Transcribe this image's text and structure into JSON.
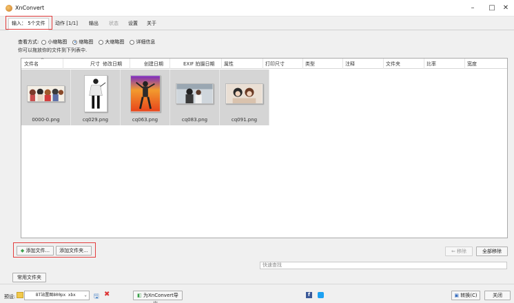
{
  "window": {
    "title": "XnConvert",
    "minimize": "–",
    "maximize": "□",
    "close": "✕"
  },
  "tabs": [
    {
      "label": "输入： 5个文件",
      "active": true
    },
    {
      "label": "动作 [1/1]"
    },
    {
      "label": "输出"
    },
    {
      "label": "状态",
      "disabled": true
    },
    {
      "label": "设置"
    },
    {
      "label": "关于"
    }
  ],
  "view": {
    "label": "查看方式:",
    "options": [
      "小缩略图",
      "缩略图",
      "大缩略图",
      "详细信息"
    ],
    "selected": "缩略图",
    "hint": "你可以拖放你的文件到下列表中."
  },
  "columns": [
    "文件名",
    "尺寸",
    "修改日期",
    "创建日期",
    "EXIF 拍摄日期",
    "属性",
    "打印尺寸",
    "类型",
    "注释",
    "文件夹",
    "比率",
    "宽度"
  ],
  "files": [
    {
      "name": "0000-0.png"
    },
    {
      "name": "cq029.png"
    },
    {
      "name": "cq063.png"
    },
    {
      "name": "cq083.png"
    },
    {
      "name": "cq091.png"
    }
  ],
  "buttons": {
    "add_files": "添加文件...",
    "add_folder": "添加文件夹...",
    "remove": "移除",
    "remove_all": "全部移除",
    "favorite_folders": "常用文件夹",
    "export_for": "为XnConvert导出...",
    "convert": "转换(C)",
    "close": "关闭"
  },
  "search": {
    "placeholder": "快速查找"
  },
  "preset": {
    "label": "预设:",
    "value": "BT站置图800px xbx"
  },
  "colors": {
    "highlight": "#e23b3b",
    "thumb_bg": "#d5d5d5",
    "list_bg": "#ffffff"
  }
}
